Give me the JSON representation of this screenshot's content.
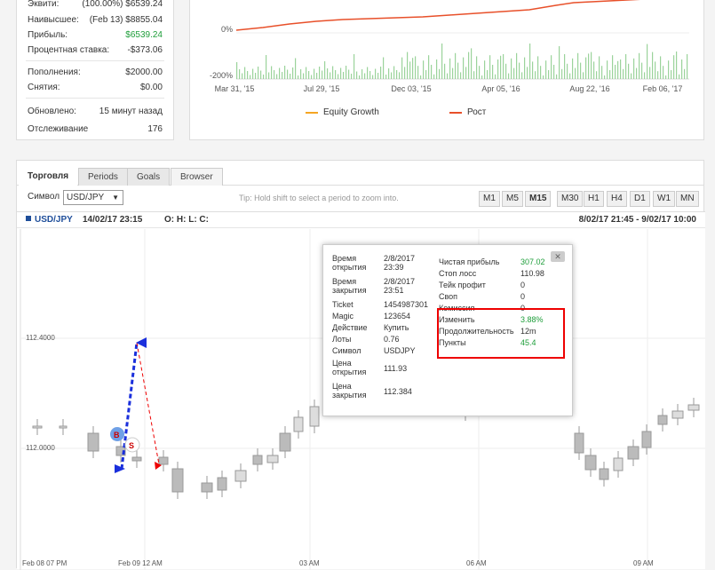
{
  "stats": {
    "rows": [
      {
        "label": "Эквити:",
        "value": "(100.00%) $6539.24",
        "green": false
      },
      {
        "label": "Наивысшее:",
        "value": "(Feb 13) $8855.04",
        "green": false
      },
      {
        "label": "Прибыль:",
        "value": "$6539.24",
        "green": true
      },
      {
        "label": "Процентная ставка:",
        "value": "-$373.06",
        "green": false
      },
      {
        "label": "Пополнения:",
        "value": "$2000.00",
        "green": false
      },
      {
        "label": "Снятия:",
        "value": "$0.00",
        "green": false
      },
      {
        "label": "Обновлено:",
        "value": "15 минут назад",
        "green": false
      },
      {
        "label": "Отслеживание",
        "value": "176",
        "green": false
      }
    ]
  },
  "growth": {
    "y_ticks": [
      "0%",
      "-200%"
    ],
    "x_ticks": [
      "Mar 31, '15",
      "Jul 29, '15",
      "Dec 03, '15",
      "Apr 05, '16",
      "Aug 22, '16",
      "Feb 06, '17"
    ],
    "legend": [
      {
        "label": "Equity Growth",
        "color": "#f5a623"
      },
      {
        "label": "Рост",
        "color": "#e8502a"
      }
    ]
  },
  "trading": {
    "tabs": [
      "Торговля",
      "Periods",
      "Goals",
      "Browser"
    ],
    "active_tab": "Browser",
    "symbol_label": "Символ",
    "symbol_value": "USD/JPY",
    "tip": "Tip: Hold shift to select a period to zoom into.",
    "periods": [
      "M1",
      "M5",
      "M15",
      "M30",
      "H1",
      "H4",
      "D1",
      "W1",
      "MN"
    ],
    "active_period": "M15",
    "chart_symbol": "USD/JPY",
    "chart_datetime": "14/02/17 23:15",
    "ohlc": "O: H: L: C:",
    "range": "8/02/17 21:45 - 9/02/17 10:00",
    "price_ticks": [
      "112.4000",
      "112.0000"
    ],
    "time_ticks": [
      "Feb 08 07 PM",
      "Feb 09 12 AM",
      "03 AM",
      "06 AM",
      "09 AM"
    ],
    "marker_buy": "B",
    "marker_sell": "S"
  },
  "popup": {
    "left": [
      {
        "label": "Время открытия",
        "value": "2/8/2017 23:39"
      },
      {
        "label": "Время закрытия",
        "value": "2/8/2017 23:51"
      },
      {
        "label": "Ticket",
        "value": "1454987301"
      },
      {
        "label": "Magic",
        "value": "123654"
      },
      {
        "label": "Действие",
        "value": "Купить"
      },
      {
        "label": "Лоты",
        "value": "0.76"
      },
      {
        "label": "Символ",
        "value": "USDJPY"
      },
      {
        "label": "Цена открытия",
        "value": "111.93"
      },
      {
        "label": "Цена закрытия",
        "value": "112.384"
      }
    ],
    "right": [
      {
        "label": "Чистая прибыль",
        "value": "307.02",
        "green": true
      },
      {
        "label": "Стоп лосс",
        "value": "110.98",
        "green": false
      },
      {
        "label": "Тейк профит",
        "value": "0",
        "green": false
      },
      {
        "label": "Своп",
        "value": "0",
        "green": false
      },
      {
        "label": "Комиссия",
        "value": "0",
        "green": false
      },
      {
        "label": "Изменить",
        "value": "3.88%",
        "green": true
      },
      {
        "label": "Продолжительность",
        "value": "12m",
        "green": false
      },
      {
        "label": "Пункты",
        "value": "45.4",
        "green": true
      }
    ],
    "close": "✕"
  }
}
